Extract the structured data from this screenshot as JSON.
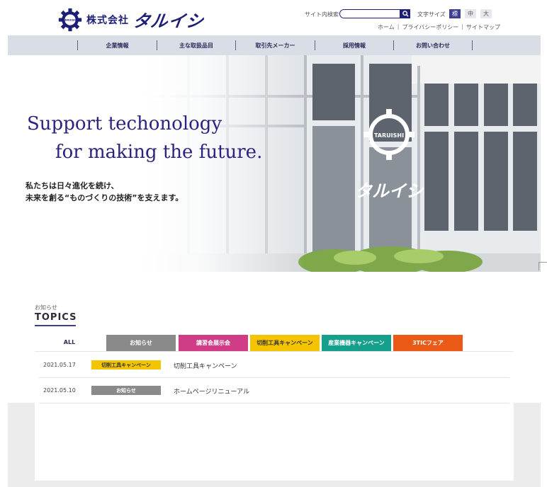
{
  "header": {
    "logo_sub": "株式会社",
    "logo_main": "タルイシ",
    "gear_text": "TARUISHI",
    "search_label": "サイト内検索",
    "search_value": "",
    "font_size_label": "文字サイズ",
    "font_sizes": [
      "標",
      "中",
      "大"
    ],
    "links": [
      "ホーム",
      "プライバシーポリシー",
      "サイトマップ"
    ],
    "link_separator": "|"
  },
  "nav": {
    "items": [
      "企業情報",
      "主な取扱品目",
      "取引先メーカー",
      "採用情報",
      "お問い合わせ"
    ]
  },
  "hero": {
    "title_line1": "Support techonology",
    "title_line2": "for making the future.",
    "desc_line1": "私たちは日々進化を続け、",
    "desc_line2": "未来を創る“ものづくりの技術”を支えます。",
    "window_logo_text": "TARUISHI",
    "window_logo_katakana": "タルイシ"
  },
  "topics": {
    "small_label": "お知らせ",
    "title": "TOPICS",
    "tabs": {
      "all": "ALL",
      "news": "お知らせ",
      "expo": "講習会展示会",
      "cut": "切削工具キャンペーン",
      "ind": "産業機器キャンペーン",
      "tic": "3TICフェア"
    },
    "rows": [
      {
        "date": "2021.05.17",
        "badge": "切削工具キャンペーン",
        "text": "切削工具キャンペーン"
      },
      {
        "date": "2021.05.10",
        "badge": "お知らせ",
        "text": "ホームページリニューアル"
      }
    ]
  },
  "colors": {
    "brand": "#1d1f76",
    "nav_bg": "#d8dde6",
    "news": "#8a8a8a",
    "expo": "#d03c86",
    "cut": "#f5c400",
    "ind": "#14a08c",
    "tic": "#ea5a16"
  }
}
